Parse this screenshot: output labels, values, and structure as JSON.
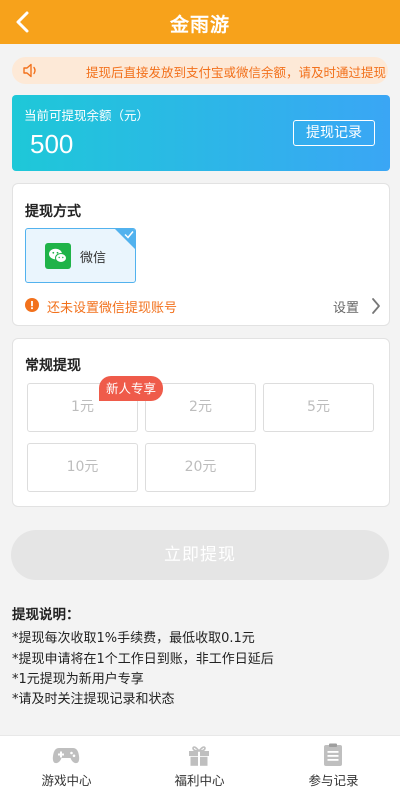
{
  "header": {
    "title": "金雨游"
  },
  "notice": {
    "text": "提现后直接发放到支付宝或微信余额，请及时通过提现"
  },
  "balance": {
    "label": "当前可提现余额（元）",
    "amount": "500",
    "records_button": "提现记录"
  },
  "method": {
    "title": "提现方式",
    "options": [
      {
        "label": "微信",
        "selected": true
      }
    ],
    "warning": "还未设置微信提现账号",
    "settings_label": "设置"
  },
  "regular": {
    "title": "常规提现",
    "badge": "新人专享",
    "amounts": [
      "1元",
      "2元",
      "5元",
      "10元",
      "20元"
    ]
  },
  "submit": {
    "label": "立即提现"
  },
  "instructions": {
    "title": "提现说明：",
    "lines": [
      "*提现每次收取1%手续费，最低收取0.1元",
      "*提现申请将在1个工作日到账，非工作日延后",
      "*1元提现为新用户专享",
      "*请及时关注提现记录和状态"
    ]
  },
  "tabbar": {
    "items": [
      {
        "label": "游戏中心",
        "icon": "gamepad-icon"
      },
      {
        "label": "福利中心",
        "icon": "gift-icon"
      },
      {
        "label": "参与记录",
        "icon": "clipboard-icon"
      }
    ]
  },
  "colors": {
    "header": "#f7a21b",
    "accent_orange": "#f2711c",
    "balance_gradient_start": "#1ec8d8",
    "balance_gradient_end": "#3aa6f5",
    "wechat_green": "#20b349",
    "badge_red": "#ef5b4a"
  }
}
